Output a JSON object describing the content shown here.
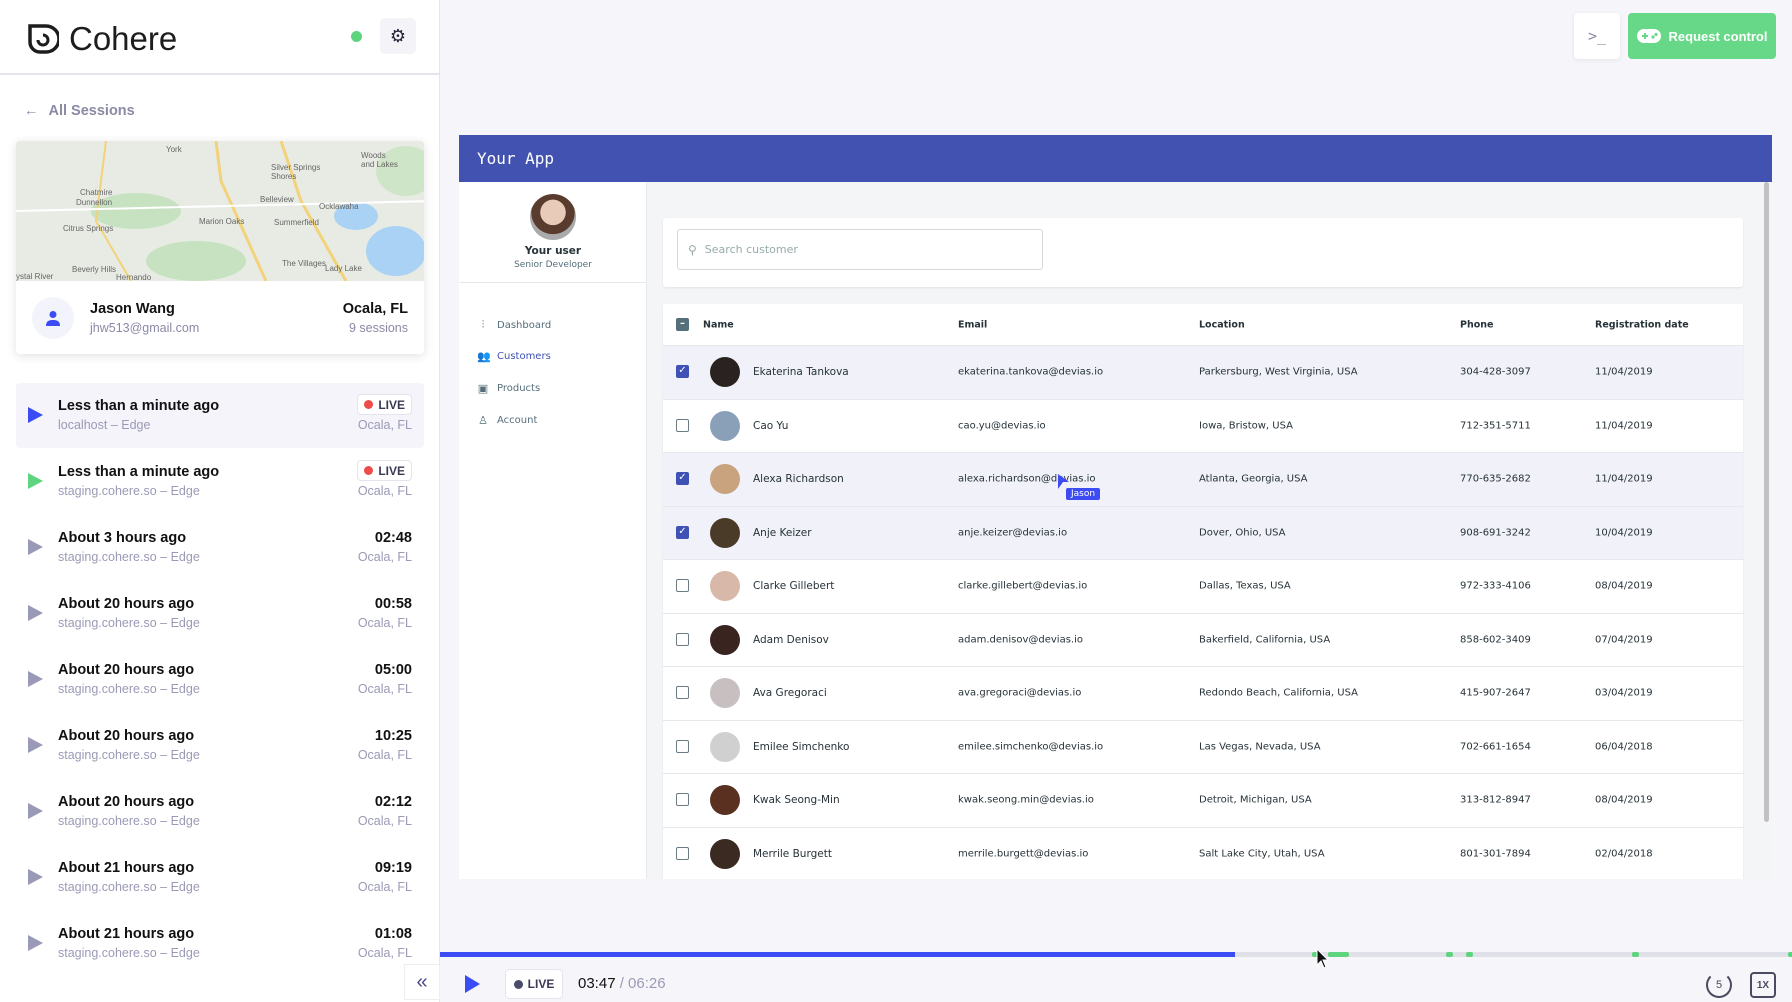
{
  "sidebar": {
    "brand": "Cohere",
    "back_label": "All Sessions",
    "user": {
      "name": "Jason Wang",
      "email": "jhw513@gmail.com",
      "location": "Ocala, FL",
      "sessions": "9 sessions"
    },
    "map_labels": [
      "York",
      "Silver Springs Shores",
      "Woods and Lakes",
      "Chatmire",
      "Dunnellon",
      "Belleview",
      "Ocklawaha",
      "Marion Oaks",
      "Summerfield",
      "Citrus Springs",
      "The Villages",
      "Lady Lake",
      "Beverly Hills",
      "Hernando",
      "ystal River"
    ],
    "sessions": [
      {
        "time": "Less than a minute ago",
        "source": "localhost – Edge",
        "duration": "",
        "live": "LIVE",
        "location": "Ocala, FL",
        "active": true,
        "play_color": "#3b4cf5"
      },
      {
        "time": "Less than a minute ago",
        "source": "staging.cohere.so – Edge",
        "duration": "",
        "live": "LIVE",
        "location": "Ocala, FL",
        "play_color": "#5fd47f"
      },
      {
        "time": "About 3 hours ago",
        "source": "staging.cohere.so – Edge",
        "duration": "02:48",
        "location": "Ocala, FL"
      },
      {
        "time": "About 20 hours ago",
        "source": "staging.cohere.so – Edge",
        "duration": "00:58",
        "location": "Ocala, FL"
      },
      {
        "time": "About 20 hours ago",
        "source": "staging.cohere.so – Edge",
        "duration": "05:00",
        "location": "Ocala, FL"
      },
      {
        "time": "About 20 hours ago",
        "source": "staging.cohere.so – Edge",
        "duration": "10:25",
        "location": "Ocala, FL"
      },
      {
        "time": "About 20 hours ago",
        "source": "staging.cohere.so – Edge",
        "duration": "02:12",
        "location": "Ocala, FL"
      },
      {
        "time": "About 21 hours ago",
        "source": "staging.cohere.so – Edge",
        "duration": "09:19",
        "location": "Ocala, FL"
      },
      {
        "time": "About 21 hours ago",
        "source": "staging.cohere.so – Edge",
        "duration": "01:08",
        "location": "Ocala, FL"
      }
    ]
  },
  "toolbar": {
    "request_control": "Request control",
    "terminal_glyph": ">_"
  },
  "app": {
    "title": "Your App",
    "user_name": "Your user",
    "user_role": "Senior Developer",
    "nav": [
      {
        "label": "Dashboard",
        "icon": "bar-chart-icon"
      },
      {
        "label": "Customers",
        "icon": "users-icon",
        "selected": true
      },
      {
        "label": "Products",
        "icon": "shopping-bag-icon"
      },
      {
        "label": "Account",
        "icon": "user-icon"
      }
    ],
    "search_placeholder": "Search customer",
    "columns": [
      "Name",
      "Email",
      "Location",
      "Phone",
      "Registration date"
    ],
    "rows": [
      {
        "name": "Ekaterina Tankova",
        "email": "ekaterina.tankova@devias.io",
        "location": "Parkersburg, West Virginia, USA",
        "phone": "304-428-3097",
        "date": "11/04/2019",
        "checked": true,
        "avatar": "#2a2220"
      },
      {
        "name": "Cao Yu",
        "email": "cao.yu@devias.io",
        "location": "Iowa, Bristow, USA",
        "phone": "712-351-5711",
        "date": "11/04/2019",
        "checked": false,
        "avatar": "#8aa0b8"
      },
      {
        "name": "Alexa Richardson",
        "email": "alexa.richardson@devias.io",
        "location": "Atlanta, Georgia, USA",
        "phone": "770-635-2682",
        "date": "11/04/2019",
        "checked": true,
        "avatar": "#c9a27e"
      },
      {
        "name": "Anje Keizer",
        "email": "anje.keizer@devias.io",
        "location": "Dover, Ohio, USA",
        "phone": "908-691-3242",
        "date": "10/04/2019",
        "checked": true,
        "avatar": "#4a3a28"
      },
      {
        "name": "Clarke Gillebert",
        "email": "clarke.gillebert@devias.io",
        "location": "Dallas, Texas, USA",
        "phone": "972-333-4106",
        "date": "08/04/2019",
        "checked": false,
        "avatar": "#d8b8a8"
      },
      {
        "name": "Adam Denisov",
        "email": "adam.denisov@devias.io",
        "location": "Bakerfield, California, USA",
        "phone": "858-602-3409",
        "date": "07/04/2019",
        "checked": false,
        "avatar": "#3a2420"
      },
      {
        "name": "Ava Gregoraci",
        "email": "ava.gregoraci@devias.io",
        "location": "Redondo Beach, California, USA",
        "phone": "415-907-2647",
        "date": "03/04/2019",
        "checked": false,
        "avatar": "#c8c0c0"
      },
      {
        "name": "Emilee Simchenko",
        "email": "emilee.simchenko@devias.io",
        "location": "Las Vegas, Nevada, USA",
        "phone": "702-661-1654",
        "date": "06/04/2018",
        "checked": false,
        "avatar": "#d0d0d0"
      },
      {
        "name": "Kwak Seong-Min",
        "email": "kwak.seong.min@devias.io",
        "location": "Detroit, Michigan, USA",
        "phone": "313-812-8947",
        "date": "08/04/2019",
        "checked": false,
        "avatar": "#5a3020"
      },
      {
        "name": "Merrile Burgett",
        "email": "merrile.burgett@devias.io",
        "location": "Salt Lake City, Utah, USA",
        "phone": "801-301-7894",
        "date": "02/04/2018",
        "checked": false,
        "avatar": "#3a2a22"
      }
    ],
    "cursor_label": "Jason"
  },
  "player": {
    "live_label": "LIVE",
    "current": "03:47",
    "total": "/ 06:26",
    "progress_percent": 58.8,
    "skip_label": "5",
    "speed_label": "1X",
    "accent": "#3b4cf5",
    "event_color": "#5fd47f"
  }
}
